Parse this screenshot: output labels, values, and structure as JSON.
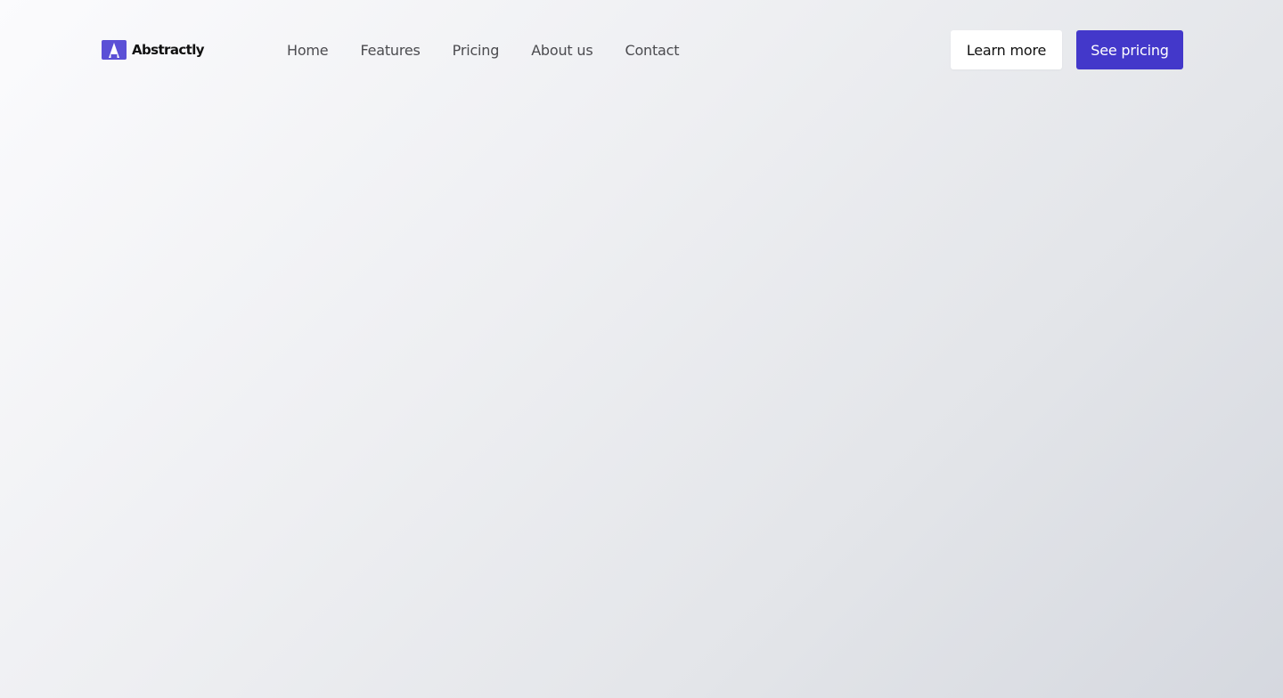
{
  "brand": {
    "name": "Abstractly",
    "logo_icon": "abstractly-logo-icon",
    "logo_color": "#5b50d6"
  },
  "nav": {
    "items": [
      {
        "label": "Home"
      },
      {
        "label": "Features"
      },
      {
        "label": "Pricing"
      },
      {
        "label": "About us"
      },
      {
        "label": "Contact"
      }
    ]
  },
  "actions": {
    "learn_more_label": "Learn more",
    "see_pricing_label": "See pricing",
    "primary_color": "#4338ca"
  }
}
